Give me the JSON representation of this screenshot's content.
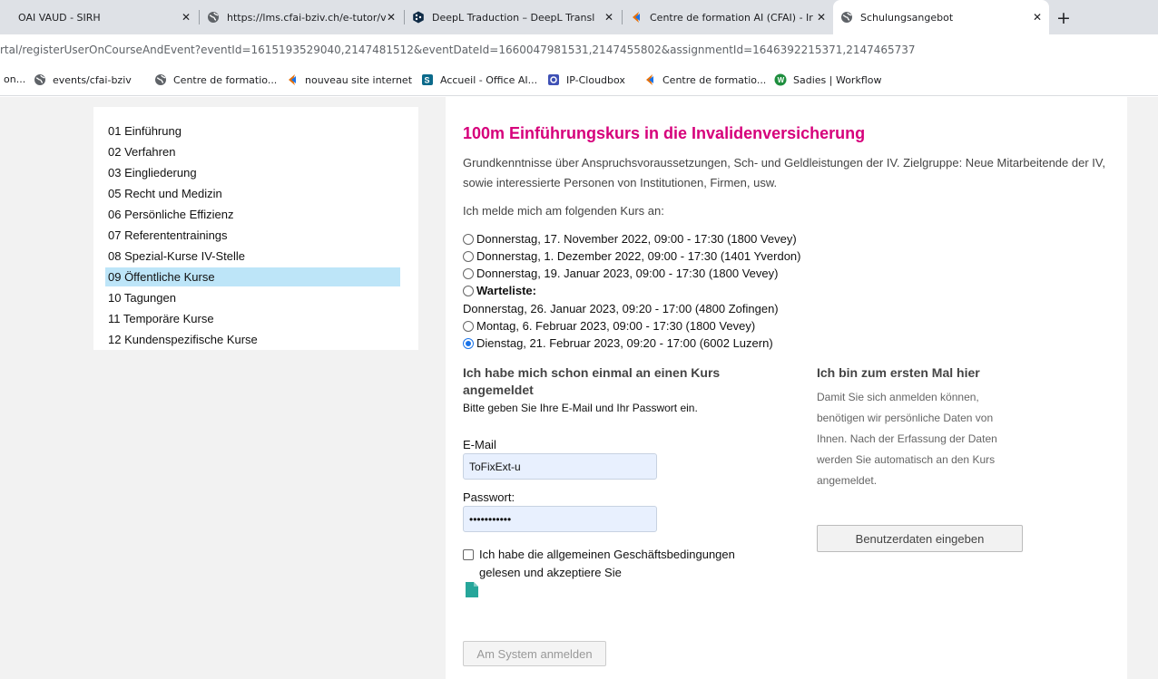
{
  "browser": {
    "tabs": [
      {
        "title": "OAI VAUD - SIRH",
        "active": false
      },
      {
        "title": "https://lms.cfai-bziv.ch/e-tutor/v",
        "active": false
      },
      {
        "title": "DeepL Traduction – DeepL Transl",
        "active": false
      },
      {
        "title": "Centre de formation AI (CFAI) - Ir",
        "active": false
      },
      {
        "title": "Schulungsangebot",
        "active": true
      }
    ],
    "tab_close": "✕",
    "new_tab": "+",
    "url": "rtal/registerUserOnCourseAndEvent?eventId=1615193529040,2147481512&eventDateId=1660047981531,2147455802&assignmentId=1646392215371,2147465737",
    "bookmarks": [
      {
        "label": "on...",
        "icon": "none"
      },
      {
        "label": "events/cfai-bziv",
        "icon": "globe-icon"
      },
      {
        "label": "Centre de formatio...",
        "icon": "globe-icon"
      },
      {
        "label": "nouveau site internet",
        "icon": "cfai-logo-icon"
      },
      {
        "label": "Accueil - Office AI...",
        "icon": "sharepoint-icon"
      },
      {
        "label": "IP-Cloudbox",
        "icon": "cloudbox-icon"
      },
      {
        "label": "Centre de formatio...",
        "icon": "cfai-logo-icon"
      },
      {
        "label": "Sadies | Workflow",
        "icon": "sadies-icon"
      }
    ]
  },
  "sidebar": {
    "items": [
      {
        "label": "01 Einführung",
        "selected": false
      },
      {
        "label": "02 Verfahren",
        "selected": false
      },
      {
        "label": "03 Eingliederung",
        "selected": false
      },
      {
        "label": "05 Recht und Medizin",
        "selected": false
      },
      {
        "label": "06 Persönliche Effizienz",
        "selected": false
      },
      {
        "label": "07 Referententrainings",
        "selected": false
      },
      {
        "label": "08 Spezial-Kurse IV-Stelle",
        "selected": false
      },
      {
        "label": "09 Öffentliche Kurse",
        "selected": true
      },
      {
        "label": "10 Tagungen",
        "selected": false
      },
      {
        "label": "11 Temporäre Kurse",
        "selected": false
      },
      {
        "label": "12 Kundenspezifische Kurse",
        "selected": false
      }
    ]
  },
  "course": {
    "title": "100m Einführungskurs in die Invalidenversicherung",
    "description": "Grundkenntnisse über Anspruchsvoraussetzungen, Sch- und Geldleistungen der IV. Zielgruppe: Neue Mitarbeitende der IV, sowie interessierte Personen von Institutionen, Firmen, usw.",
    "intro": "Ich melde mich am folgenden Kurs an:",
    "options": [
      {
        "label": "Donnerstag, 17. November 2022, 09:00 - 17:30  (1800 Vevey)",
        "checked": false
      },
      {
        "label": "Donnerstag, 1. Dezember 2022, 09:00 - 17:30  (1401 Yverdon)",
        "checked": false
      },
      {
        "label": "Donnerstag, 19. Januar 2023, 09:00 - 17:30  (1800 Vevey)",
        "checked": false
      },
      {
        "label": "Warteliste:",
        "checked": false,
        "bold": true
      },
      {
        "label": "Montag, 6. Februar 2023, 09:00 - 17:30  (1800 Vevey)",
        "checked": false
      },
      {
        "label": "Dienstag, 21. Februar 2023, 09:20 - 17:00  (6002 Luzern)",
        "checked": true,
        "accent": "#1a73e8"
      }
    ],
    "waitlist_note": "Donnerstag, 26. Januar 2023, 09:20 - 17:00  (4800 Zofingen)"
  },
  "login": {
    "heading": "Ich habe mich schon einmal an einen Kurs angemeldet",
    "instructions": "Bitte geben Sie Ihre E-Mail und Ihr Passwort ein.",
    "email_label": "E-Mail",
    "email_value": "ToFixExt-u",
    "password_label": "Passwort:",
    "password_value": "•••••••••••",
    "terms_label": "Ich habe die allgemeinen Geschäftsbedingungen gelesen und akzeptiere Sie",
    "terms_checked": false,
    "submit_label": "Am System anmelden",
    "submit_disabled": true
  },
  "register": {
    "heading": "Ich bin zum ersten Mal hier",
    "text": "Damit Sie sich anmelden können, benötigen wir persönliche Daten von Ihnen. Nach der Erfassung der Daten werden Sie automatisch an den Kurs angemeldet.",
    "button_label": "Benutzerdaten eingeben"
  },
  "colors": {
    "title": "#d6007b",
    "selected_item": "#bde5f8",
    "autofill": "#e8f0fe",
    "doc_icon": "#26a69a"
  }
}
